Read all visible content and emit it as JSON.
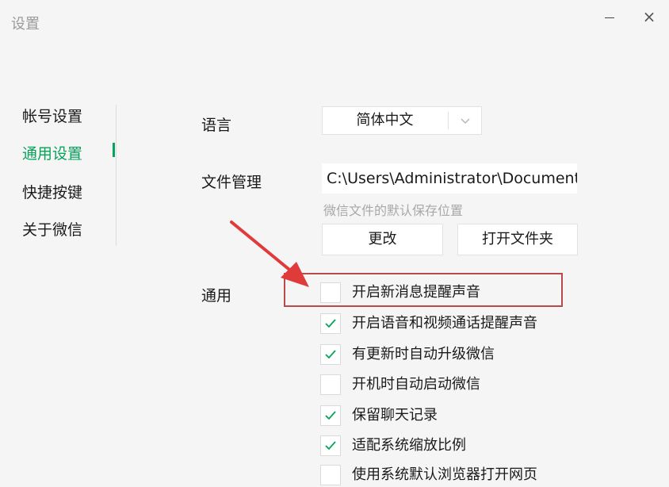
{
  "window": {
    "title": "设置"
  },
  "sidebar": {
    "items": [
      {
        "label": "帐号设置",
        "active": false
      },
      {
        "label": "通用设置",
        "active": true
      },
      {
        "label": "快捷按键",
        "active": false
      },
      {
        "label": "关于微信",
        "active": false
      }
    ]
  },
  "settings": {
    "language_label": "语言",
    "language_value": "简体中文",
    "file_label": "文件管理",
    "file_path": "C:\\Users\\Administrator\\Documents\\WeChat Files",
    "file_hint": "微信文件的默认保存位置",
    "change_button": "更改",
    "open_folder_button": "打开文件夹",
    "general_label": "通用",
    "options": [
      {
        "label": "开启新消息提醒声音",
        "checked": false
      },
      {
        "label": "开启语音和视频通话提醒声音",
        "checked": true
      },
      {
        "label": "有更新时自动升级微信",
        "checked": true
      },
      {
        "label": "开机时自动启动微信",
        "checked": false
      },
      {
        "label": "保留聊天记录",
        "checked": true
      },
      {
        "label": "适配系统缩放比例",
        "checked": true
      },
      {
        "label": "使用系统默认浏览器打开网页",
        "checked": false
      }
    ]
  },
  "colors": {
    "accent": "#07a35a",
    "highlight": "#b84a4a",
    "arrow": "#e03b3b"
  }
}
